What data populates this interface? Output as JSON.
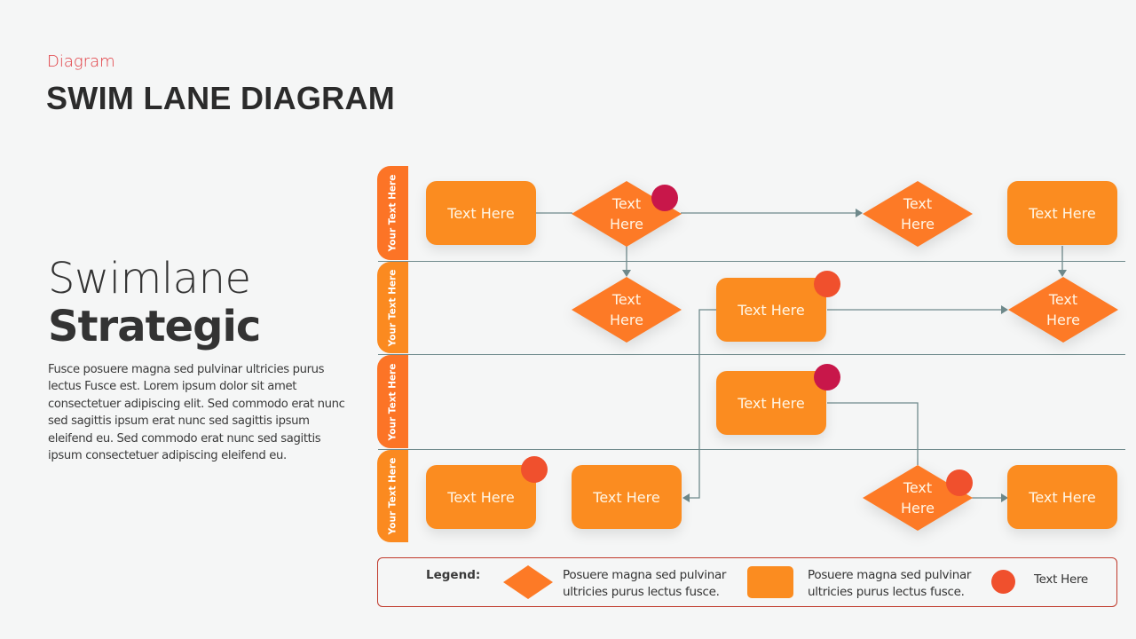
{
  "header": {
    "category": "Diagram",
    "title": "SWIM LANE DIAGRAM"
  },
  "intro": {
    "subtitle_light": "Swimlane",
    "subtitle_bold": "Strategic",
    "body": "Fusce posuere magna sed pulvinar ultricies purus lectus Fusce est. Lorem ipsum dolor sit amet consectetuer adipiscing elit. Sed commodo  erat nunc sed sagittis ipsum erat nunc sed sagittis ipsum eleifend eu. Sed commodo  erat nunc sed sagittis ipsum consectetuer adipiscing eleifend eu."
  },
  "colors": {
    "box": "#fb8c20",
    "diamond": "#fd7a26",
    "lane_tab_a": "#fc7426",
    "lane_tab_b": "#fb8a20",
    "connector": "#6f8a8c",
    "dot_crimson": "#c8174a",
    "dot_red": "#f0502d",
    "accent": "#e0383e",
    "legend_border": "#c0392b"
  },
  "lanes": [
    {
      "label": "Your Text Here"
    },
    {
      "label": "Your Text Here"
    },
    {
      "label": "Your Text Here"
    },
    {
      "label": "Your Text Here"
    }
  ],
  "nodes": {
    "l1_box_a": {
      "shape": "process",
      "lane": 1,
      "text": "Text Here"
    },
    "l1_diamond_a": {
      "shape": "decision",
      "lane": 1,
      "text": "Text Here",
      "marker": "crimson"
    },
    "l1_diamond_b": {
      "shape": "decision",
      "lane": 1,
      "text": "Text Here"
    },
    "l1_box_b": {
      "shape": "process",
      "lane": 1,
      "text": "Text Here"
    },
    "l2_diamond_a": {
      "shape": "decision",
      "lane": 2,
      "text": "Text Here"
    },
    "l2_box_a": {
      "shape": "process",
      "lane": 2,
      "text": "Text Here",
      "marker": "red"
    },
    "l2_diamond_b": {
      "shape": "decision",
      "lane": 2,
      "text": "Text Here"
    },
    "l3_box_a": {
      "shape": "process",
      "lane": 3,
      "text": "Text Here",
      "marker": "crimson"
    },
    "l4_box_a": {
      "shape": "process",
      "lane": 4,
      "text": "Text Here",
      "marker": "red"
    },
    "l4_box_b": {
      "shape": "process",
      "lane": 4,
      "text": "Text Here"
    },
    "l4_diamond_a": {
      "shape": "decision",
      "lane": 4,
      "text": "Text Here",
      "marker": "red"
    },
    "l4_box_c": {
      "shape": "process",
      "lane": 4,
      "text": "Text Here"
    }
  },
  "edges": [
    {
      "from": "l1_box_a",
      "to": "l1_diamond_a",
      "arrow": false
    },
    {
      "from": "l1_diamond_a",
      "to": "l1_diamond_b",
      "arrow": true
    },
    {
      "from": "l1_diamond_a",
      "to": "l2_diamond_a",
      "arrow": true
    },
    {
      "from": "l1_box_b",
      "to": "l2_diamond_b",
      "arrow": true
    },
    {
      "from": "l2_box_a",
      "to": "l2_diamond_b",
      "arrow": true
    },
    {
      "from": "l2_box_a",
      "to": "l4_box_b",
      "arrow": true
    },
    {
      "from": "l3_box_a",
      "to": "l4_diamond_a",
      "arrow": false
    },
    {
      "from": "l4_diamond_a",
      "to": "l4_box_c",
      "arrow": true
    }
  ],
  "legend": {
    "label": "Legend:",
    "decision_text_1": "Posuere magna sed pulvinar",
    "decision_text_2": "ultricies purus lectus fusce.",
    "process_text_1": "Posuere magna sed pulvinar",
    "process_text_2": "ultricies purus lectus fusce.",
    "marker_text": "Text Here"
  }
}
